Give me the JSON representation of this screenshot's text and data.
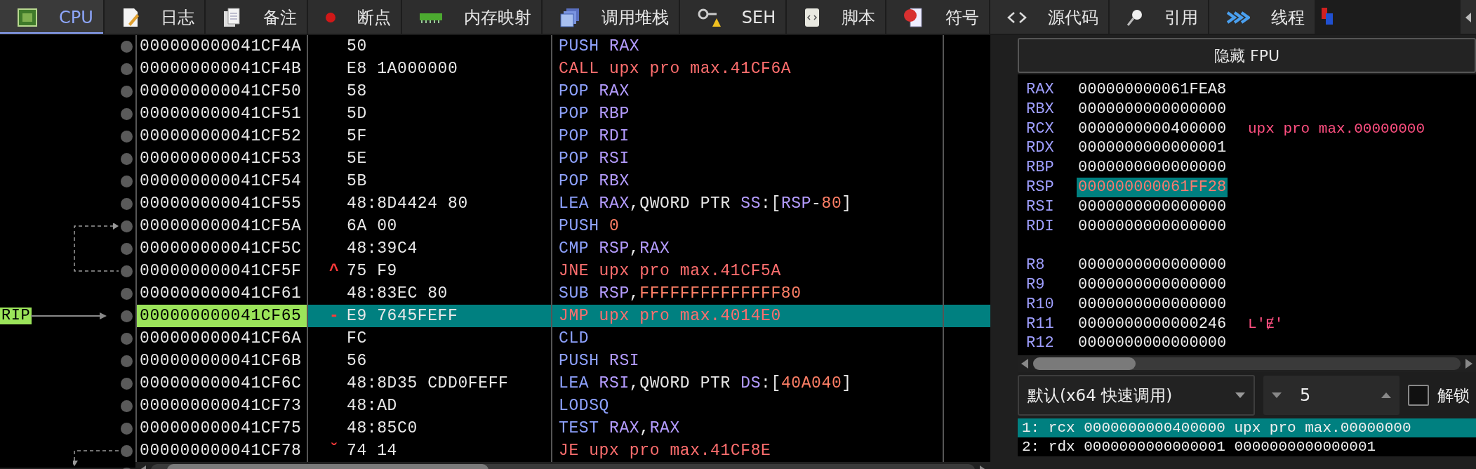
{
  "tabs": [
    {
      "label": "CPU",
      "selected": true
    },
    {
      "label": "日志",
      "selected": false
    },
    {
      "label": "备注",
      "selected": false
    },
    {
      "label": "断点",
      "selected": false
    },
    {
      "label": "内存映射",
      "selected": false
    },
    {
      "label": "调用堆栈",
      "selected": false
    },
    {
      "label": "SEH",
      "selected": false
    },
    {
      "label": "脚本",
      "selected": false
    },
    {
      "label": "符号",
      "selected": false
    },
    {
      "label": "源代码",
      "selected": false
    },
    {
      "label": "引用",
      "selected": false
    },
    {
      "label": "线程",
      "selected": false
    }
  ],
  "disassembly": {
    "rows": [
      {
        "address": "000000000041CF4A",
        "bytes": "50",
        "instruction": [
          {
            "text": "PUSH ",
            "kind": "normal"
          },
          {
            "text": "RAX",
            "kind": "register"
          }
        ],
        "selected": false
      },
      {
        "address": "000000000041CF4B",
        "bytes": "E8 1A000000",
        "instruction": [
          {
            "text": "CALL ",
            "kind": "branch"
          },
          {
            "text": "upx pro max.41CF6A",
            "kind": "target"
          }
        ],
        "selected": false
      },
      {
        "address": "000000000041CF50",
        "bytes": "58",
        "instruction": [
          {
            "text": "POP ",
            "kind": "normal"
          },
          {
            "text": "RAX",
            "kind": "register"
          }
        ],
        "selected": false
      },
      {
        "address": "000000000041CF51",
        "bytes": "5D",
        "instruction": [
          {
            "text": "POP ",
            "kind": "normal"
          },
          {
            "text": "RBP",
            "kind": "register"
          }
        ],
        "selected": false
      },
      {
        "address": "000000000041CF52",
        "bytes": "5F",
        "instruction": [
          {
            "text": "POP ",
            "kind": "normal"
          },
          {
            "text": "RDI",
            "kind": "register"
          }
        ],
        "selected": false
      },
      {
        "address": "000000000041CF53",
        "bytes": "5E",
        "instruction": [
          {
            "text": "POP ",
            "kind": "normal"
          },
          {
            "text": "RSI",
            "kind": "register"
          }
        ],
        "selected": false
      },
      {
        "address": "000000000041CF54",
        "bytes": "5B",
        "instruction": [
          {
            "text": "POP ",
            "kind": "normal"
          },
          {
            "text": "RBX",
            "kind": "register"
          }
        ],
        "selected": false
      },
      {
        "address": "000000000041CF55",
        "bytes": "48:8D4424 80",
        "instruction": [
          {
            "text": "LEA ",
            "kind": "normal"
          },
          {
            "text": "RAX",
            "kind": "register"
          },
          {
            "text": ",QWORD PTR ",
            "kind": "plain"
          },
          {
            "text": "SS",
            "kind": "segment"
          },
          {
            "text": ":[",
            "kind": "plain"
          },
          {
            "text": "RSP",
            "kind": "register"
          },
          {
            "text": "-",
            "kind": "plain"
          },
          {
            "text": "80",
            "kind": "number"
          },
          {
            "text": "]",
            "kind": "plain"
          }
        ],
        "selected": false
      },
      {
        "address": "000000000041CF5A",
        "bytes": "6A 00",
        "instruction": [
          {
            "text": "PUSH ",
            "kind": "normal"
          },
          {
            "text": "0",
            "kind": "number"
          }
        ],
        "selected": false
      },
      {
        "address": "000000000041CF5C",
        "bytes": "48:39C4",
        "instruction": [
          {
            "text": "CMP ",
            "kind": "normal"
          },
          {
            "text": "RSP",
            "kind": "register"
          },
          {
            "text": ",",
            "kind": "plain"
          },
          {
            "text": "RAX",
            "kind": "register"
          }
        ],
        "selected": false
      },
      {
        "address": "000000000041CF5F",
        "branch_hint": "^",
        "bytes": "75 F9",
        "instruction": [
          {
            "text": "JNE ",
            "kind": "branch"
          },
          {
            "text": "upx pro max.41CF5A",
            "kind": "target"
          }
        ],
        "selected": false
      },
      {
        "address": "000000000041CF61",
        "bytes": "48:83EC 80",
        "instruction": [
          {
            "text": "SUB ",
            "kind": "normal"
          },
          {
            "text": "RSP",
            "kind": "register"
          },
          {
            "text": ",",
            "kind": "plain"
          },
          {
            "text": "FFFFFFFFFFFFFF80",
            "kind": "number"
          }
        ],
        "selected": false
      },
      {
        "address": "000000000041CF65",
        "rip": "RIP",
        "branch_hint": "-",
        "bytes": "E9 7645FEFF",
        "instruction": [
          {
            "text": "JMP ",
            "kind": "branch"
          },
          {
            "text": "upx pro max.4014E0",
            "kind": "target"
          }
        ],
        "selected": true
      },
      {
        "address": "000000000041CF6A",
        "bytes": "FC",
        "instruction": [
          {
            "text": "CLD",
            "kind": "normal"
          }
        ],
        "selected": false
      },
      {
        "address": "000000000041CF6B",
        "bytes": "56",
        "instruction": [
          {
            "text": "PUSH ",
            "kind": "normal"
          },
          {
            "text": "RSI",
            "kind": "register"
          }
        ],
        "selected": false
      },
      {
        "address": "000000000041CF6C",
        "bytes": "48:8D35 CDD0FEFF",
        "instruction": [
          {
            "text": "LEA ",
            "kind": "normal"
          },
          {
            "text": "RSI",
            "kind": "register"
          },
          {
            "text": ",QWORD PTR ",
            "kind": "plain"
          },
          {
            "text": "DS",
            "kind": "segment"
          },
          {
            "text": ":[",
            "kind": "plain"
          },
          {
            "text": "40A040",
            "kind": "number"
          },
          {
            "text": "]",
            "kind": "plain"
          }
        ],
        "selected": false
      },
      {
        "address": "000000000041CF73",
        "bytes": "48:AD",
        "instruction": [
          {
            "text": "LODSQ",
            "kind": "normal"
          }
        ],
        "selected": false
      },
      {
        "address": "000000000041CF75",
        "bytes": "48:85C0",
        "instruction": [
          {
            "text": "TEST ",
            "kind": "normal"
          },
          {
            "text": "RAX",
            "kind": "register"
          },
          {
            "text": ",",
            "kind": "plain"
          },
          {
            "text": "RAX",
            "kind": "register"
          }
        ],
        "selected": false
      },
      {
        "address": "000000000041CF78",
        "branch_hint": "ˇ",
        "bytes": "74 14",
        "instruction": [
          {
            "text": "JE ",
            "kind": "branch"
          },
          {
            "text": "upx pro max.41CF8E",
            "kind": "target"
          }
        ],
        "selected": false
      }
    ]
  },
  "registers": {
    "toggle_button": "隐藏 FPU",
    "groups": [
      [
        {
          "name": "RAX",
          "value": "000000000061FEA8",
          "selected": false,
          "changed": false
        },
        {
          "name": "RBX",
          "value": "0000000000000000",
          "selected": false,
          "changed": false
        },
        {
          "name": "RCX",
          "value": "0000000000400000",
          "comment": "upx pro max.00000000",
          "selected": false,
          "changed": false
        },
        {
          "name": "RDX",
          "value": "0000000000000001",
          "selected": false,
          "changed": false
        },
        {
          "name": "RBP",
          "value": "0000000000000000",
          "selected": false,
          "changed": false
        },
        {
          "name": "RSP",
          "value": "000000000061FF28",
          "selected": true,
          "changed": true
        },
        {
          "name": "RSI",
          "value": "0000000000000000",
          "selected": false,
          "changed": false
        },
        {
          "name": "RDI",
          "value": "0000000000000000",
          "selected": false,
          "changed": false
        }
      ],
      [
        {
          "name": "R8",
          "value": "0000000000000000",
          "selected": false,
          "changed": false
        },
        {
          "name": "R9",
          "value": "0000000000000000",
          "selected": false,
          "changed": false
        },
        {
          "name": "R10",
          "value": "0000000000000000",
          "selected": false,
          "changed": false
        },
        {
          "name": "R11",
          "value": "0000000000000246",
          "comment": "L'Ɇ'",
          "selected": false,
          "changed": false
        },
        {
          "name": "R12",
          "value": "0000000000000000",
          "selected": false,
          "changed": false
        }
      ]
    ]
  },
  "call_convention": {
    "value": "默认(x64 快速调用)"
  },
  "argument_count": {
    "value": "5"
  },
  "lock": {
    "label": "解锁",
    "checked": false
  },
  "arguments": [
    {
      "text": "1: rcx 0000000000400000 upx pro max.00000000",
      "selected": true
    },
    {
      "text": "2: rdx 0000000000000001 0000000000000001",
      "selected": false
    }
  ]
}
